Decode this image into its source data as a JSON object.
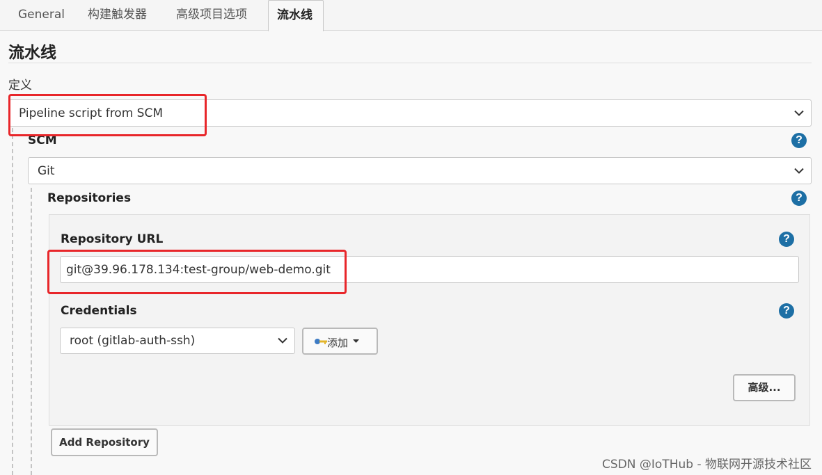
{
  "tabs": [
    {
      "label": "General"
    },
    {
      "label": "构建触发器"
    },
    {
      "label": "高级项目选项"
    },
    {
      "label": "流水线"
    }
  ],
  "section_title": "流水线",
  "definition": {
    "label": "定义",
    "selected": "Pipeline script from SCM"
  },
  "scm": {
    "label": "SCM",
    "selected": "Git"
  },
  "repositories": {
    "label": "Repositories",
    "url_label": "Repository URL",
    "url_value": "git@39.96.178.134:test-group/web-demo.git",
    "credentials_label": "Credentials",
    "credentials_selected": "root (gitlab-auth-ssh)",
    "add_label": "添加",
    "advanced_label": "高级...",
    "add_repository_label": "Add Repository"
  },
  "help_glyph": "?",
  "watermark": "CSDN @IoTHub - 物联网开源技术社区",
  "colors": {
    "highlight": "#e8262a",
    "help_icon": "#1d6fa5"
  }
}
